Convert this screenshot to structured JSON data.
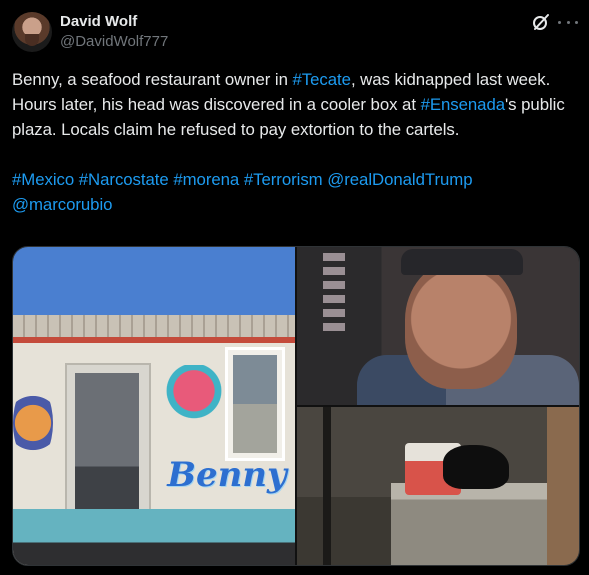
{
  "author": {
    "display_name": "David Wolf",
    "handle": "@DavidWolf777"
  },
  "icons": {
    "avatar": "profile-avatar",
    "grok": "grok-icon",
    "more": "more-options-icon"
  },
  "tweet": {
    "line1_pre": "Benny, a seafood restaurant owner in ",
    "tag_tecate": "#Tecate",
    "line1_post": ", was kidnapped last week. Hours later, his head was discovered in a cooler box at ",
    "tag_ensenada": "#Ensenada",
    "line2_post": "'s public plaza. Locals claim he refused to pay extortion to the cartels.",
    "hashtags": [
      "#Mexico",
      "#Narcostate",
      "#morena",
      "#Terrorism"
    ],
    "mentions": [
      "@realDonaldTrump",
      "@marcorubio"
    ]
  },
  "media": {
    "sign_text": "Benny"
  },
  "colors": {
    "background": "#000000",
    "text": "#e7e9ea",
    "secondary": "#71767b",
    "link": "#1d9bf0"
  }
}
